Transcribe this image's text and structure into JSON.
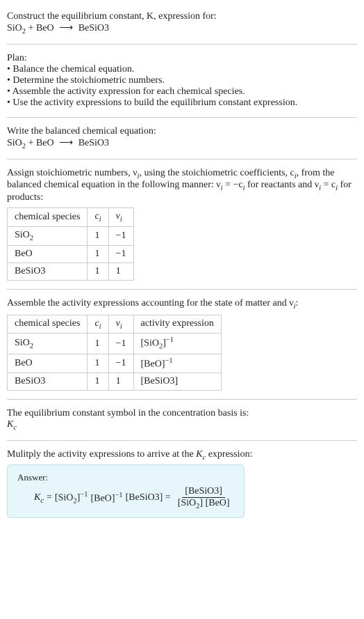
{
  "title_line1": "Construct the equilibrium constant, K, expression for:",
  "equation_reactant1": "SiO",
  "equation_reactant1_sub": "2",
  "equation_plus": " + ",
  "equation_reactant2": "BeO",
  "equation_arrow": "⟶",
  "equation_product": "BeSiO3",
  "plan_heading": "Plan:",
  "plan_bullet1": "• Balance the chemical equation.",
  "plan_bullet2": "• Determine the stoichiometric numbers.",
  "plan_bullet3": "• Assemble the activity expression for each chemical species.",
  "plan_bullet4": "• Use the activity expressions to build the equilibrium constant expression.",
  "balanced_heading": "Write the balanced chemical equation:",
  "stoich_text1": "Assign stoichiometric numbers, ν",
  "stoich_text1_sub": "i",
  "stoich_text2": ", using the stoichiometric coefficients, c",
  "stoich_text2_sub": "i",
  "stoich_text3": ", from the balanced chemical equation in the following manner: ν",
  "stoich_text3_sub": "i",
  "stoich_text4": " = −c",
  "stoich_text4_sub": "i",
  "stoich_text5": " for reactants and ν",
  "stoich_text5_sub": "i",
  "stoich_text6": " = c",
  "stoich_text6_sub": "i",
  "stoich_text7": " for products:",
  "table1": {
    "col1": "chemical species",
    "col2": "c",
    "col2_sub": "i",
    "col3": "ν",
    "col3_sub": "i",
    "rows": [
      {
        "species": "SiO",
        "species_sub": "2",
        "c": "1",
        "v": "−1"
      },
      {
        "species": "BeO",
        "species_sub": "",
        "c": "1",
        "v": "−1"
      },
      {
        "species": "BeSiO3",
        "species_sub": "",
        "c": "1",
        "v": "1"
      }
    ]
  },
  "activity_heading": "Assemble the activity expressions accounting for the state of matter and ν",
  "activity_heading_sub": "i",
  "activity_heading_end": ":",
  "table2": {
    "col1": "chemical species",
    "col2": "c",
    "col2_sub": "i",
    "col3": "ν",
    "col3_sub": "i",
    "col4": "activity expression",
    "rows": [
      {
        "species": "SiO",
        "species_sub": "2",
        "c": "1",
        "v": "−1",
        "expr": "[SiO",
        "expr_sub": "2",
        "expr_close": "]",
        "expr_sup": "−1"
      },
      {
        "species": "BeO",
        "species_sub": "",
        "c": "1",
        "v": "−1",
        "expr": "[BeO]",
        "expr_sub": "",
        "expr_close": "",
        "expr_sup": "−1"
      },
      {
        "species": "BeSiO3",
        "species_sub": "",
        "c": "1",
        "v": "1",
        "expr": "[BeSiO3]",
        "expr_sub": "",
        "expr_close": "",
        "expr_sup": ""
      }
    ]
  },
  "symbol_heading": "The equilibrium constant symbol in the concentration basis is:",
  "symbol": "K",
  "symbol_sub": "c",
  "multiply_heading1": "Mulitply the activity expressions to arrive at the ",
  "multiply_heading2": "K",
  "multiply_heading2_sub": "c",
  "multiply_heading3": " expression:",
  "answer_label": "Answer:",
  "kc": "K",
  "kc_sub": "c",
  "eq_sign": " = ",
  "term1": "[SiO",
  "term1_sub": "2",
  "term1_close": "]",
  "term1_sup": "−1",
  "term2": " [BeO]",
  "term2_sup": "−1",
  "term3": " [BeSiO3] = ",
  "frac_num": "[BeSiO3]",
  "frac_den1": "[SiO",
  "frac_den1_sub": "2",
  "frac_den2": "] [BeO]"
}
